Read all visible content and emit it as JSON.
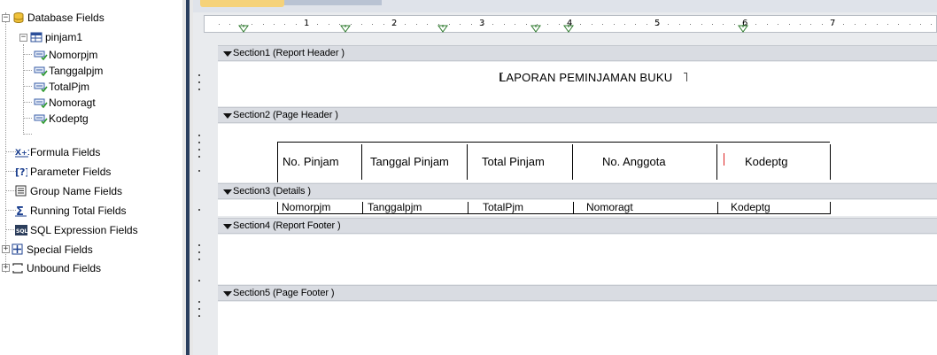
{
  "explorer": {
    "root": {
      "label": "Database Fields",
      "expander": "−",
      "icon": "database-icon"
    },
    "table": {
      "label": "pinjam1",
      "expander": "−",
      "icon": "table-icon"
    },
    "fields": [
      {
        "label": "Nomorpjm",
        "icon": "field-icon"
      },
      {
        "label": "Tanggalpjm",
        "icon": "field-icon"
      },
      {
        "label": "TotalPjm",
        "icon": "field-icon"
      },
      {
        "label": "Nomoragt",
        "icon": "field-icon"
      },
      {
        "label": "Kodeptg",
        "icon": "field-icon"
      }
    ],
    "groups": [
      {
        "label": "Formula Fields",
        "icon": "formula-icon",
        "glyph": "X+1"
      },
      {
        "label": "Parameter Fields",
        "icon": "parameter-icon",
        "glyph": "[?]"
      },
      {
        "label": "Group Name Fields",
        "icon": "group-name-icon",
        "glyph": ""
      },
      {
        "label": "Running Total Fields",
        "icon": "running-total-icon",
        "glyph": "Σ"
      },
      {
        "label": "SQL Expression Fields",
        "icon": "sql-icon",
        "glyph": "SQL"
      },
      {
        "label": "Special Fields",
        "icon": "special-fields-icon",
        "glyph": "",
        "expander": "+"
      },
      {
        "label": "Unbound Fields",
        "icon": "unbound-fields-icon",
        "glyph": "",
        "expander": "+"
      }
    ]
  },
  "ruler": {
    "numbers": [
      "1",
      "2",
      "3",
      "4",
      "5",
      "6",
      "7"
    ]
  },
  "sections": [
    {
      "label": "Section1 (Report Header )"
    },
    {
      "label": "Section2 (Page Header )"
    },
    {
      "label": "Section3 (Details )"
    },
    {
      "label": "Section4 (Report Footer )"
    },
    {
      "label": "Section5 (Page Footer )"
    }
  ],
  "report_header": {
    "title": "LAPORAN PEMINJAMAN BUKU"
  },
  "page_header": {
    "columns": [
      "No. Pinjam",
      "Tanggal Pinjam",
      "Total Pinjam",
      "No. Anggota",
      "Kodeptg"
    ]
  },
  "details": {
    "fields": [
      "Nomorpjm",
      "Tanggalpjm",
      "TotalPjm",
      "Nomoragt",
      "Kodeptg"
    ]
  },
  "colors": {
    "section_bar": "#d9dce2",
    "splitter": "#2a3f5f",
    "surface": "#e9ebee",
    "tab_active": "#f5d27a"
  }
}
